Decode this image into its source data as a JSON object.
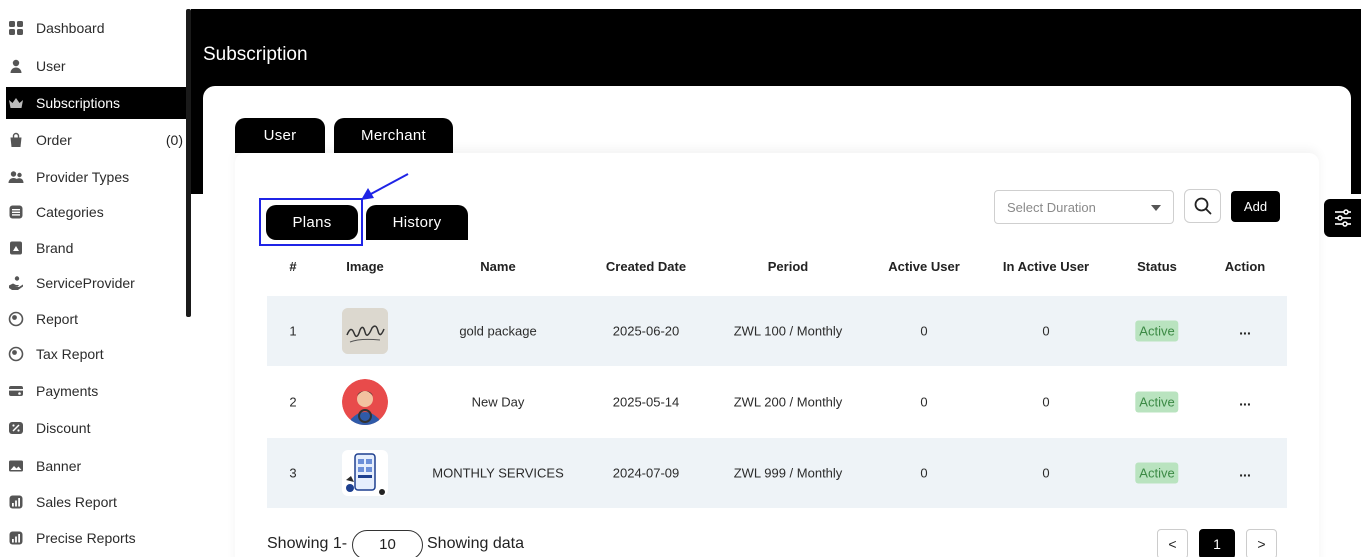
{
  "sidebar": {
    "items": [
      {
        "label": "Dashboard",
        "icon": "dashboard-icon"
      },
      {
        "label": "User",
        "icon": "user-icon"
      },
      {
        "label": "Subscriptions",
        "icon": "crown-icon",
        "active": true
      },
      {
        "label": "Order",
        "icon": "shopping-bag-icon",
        "count": "(0)"
      },
      {
        "label": "Provider Types",
        "icon": "users-icon"
      },
      {
        "label": "Categories",
        "icon": "list-icon"
      },
      {
        "label": "Brand",
        "icon": "tag-icon"
      },
      {
        "label": "ServiceProvider",
        "icon": "hand-icon"
      },
      {
        "label": "Report",
        "icon": "report-icon"
      },
      {
        "label": "Tax Report",
        "icon": "tax-icon"
      },
      {
        "label": "Payments",
        "icon": "payments-icon"
      },
      {
        "label": "Discount",
        "icon": "discount-icon"
      },
      {
        "label": "Banner",
        "icon": "image-icon"
      },
      {
        "label": "Sales Report",
        "icon": "chart-icon"
      },
      {
        "label": "Precise Reports",
        "icon": "chart-icon"
      }
    ]
  },
  "header": {
    "title": "Subscription"
  },
  "top_tabs": [
    {
      "label": "User"
    },
    {
      "label": "Merchant"
    }
  ],
  "sub_tabs": [
    {
      "label": "Plans"
    },
    {
      "label": "History"
    }
  ],
  "toolbar": {
    "select_placeholder": "Select Duration",
    "add_label": "Add"
  },
  "table": {
    "columns": [
      "#",
      "Image",
      "Name",
      "Created Date",
      "Period",
      "Active User",
      "In Active User",
      "Status",
      "Action"
    ],
    "rows": [
      {
        "num": "1",
        "image": "signature-thumbnail",
        "name": "gold package",
        "created": "2025-06-20",
        "period": "ZWL 100 / Monthly",
        "active": "0",
        "inactive": "0",
        "status": "Active",
        "action": "..."
      },
      {
        "num": "2",
        "image": "avatar-thumbnail",
        "name": "New Day",
        "created": "2025-05-14",
        "period": "ZWL 200 / Monthly",
        "active": "0",
        "inactive": "0",
        "status": "Active",
        "action": "..."
      },
      {
        "num": "3",
        "image": "phone-app-thumbnail",
        "name": "MONTHLY SERVICES",
        "created": "2024-07-09",
        "period": "ZWL 999 / Monthly",
        "active": "0",
        "inactive": "0",
        "status": "Active",
        "action": "..."
      }
    ]
  },
  "footer": {
    "showing_prefix": "Showing 1-",
    "per_page": "10",
    "showing_suffix": "Showing data",
    "prev": "<",
    "page": "1",
    "next": ">"
  },
  "colors": {
    "accent": "#000000",
    "highlight": "#1f24e6",
    "status_bg": "#b9e3bf",
    "status_text": "#3c8a45",
    "row_alt": "#eef3f7"
  }
}
